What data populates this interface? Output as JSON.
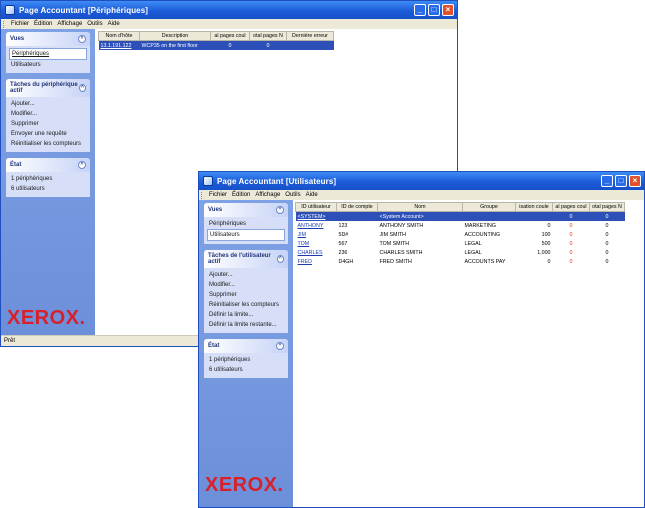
{
  "w1": {
    "title": "Page Accountant [Périphériques]",
    "menu": [
      "Fichier",
      "Édition",
      "Affichage",
      "Outils",
      "Aide"
    ],
    "panes": {
      "vues": {
        "title": "Vues",
        "items": [
          "Périphériques",
          "Utilisateurs"
        ]
      },
      "taches": {
        "title": "Tâches du périphérique actif",
        "items": [
          "Ajouter...",
          "Modifier...",
          "Supprimer",
          "Envoyer une requête",
          "Réinitialiser les compteurs"
        ]
      },
      "etat": {
        "title": "État",
        "items": [
          "1 périphériques",
          "6 utilisateurs"
        ]
      }
    },
    "logo": "XEROX.",
    "status": "Prêt",
    "table": {
      "headers": [
        "Nom d'hôte",
        "Description",
        "al pages coul",
        "otal pages N",
        "Dernière erreur"
      ],
      "rows": [
        [
          "13.1.191.122",
          "WCP35 on the first floor",
          "0",
          "0",
          ""
        ]
      ]
    }
  },
  "w2": {
    "title": "Page Accountant [Utilisateurs]",
    "menu": [
      "Fichier",
      "Édition",
      "Affichage",
      "Outils",
      "Aide"
    ],
    "panes": {
      "vues": {
        "title": "Vues",
        "items": [
          "Périphériques",
          "Utilisateurs"
        ]
      },
      "taches": {
        "title": "Tâches de l'utilisateur actif",
        "items": [
          "Ajouter...",
          "Modifier...",
          "Supprimer",
          "Réinitialiser les compteurs",
          "Définir la limite...",
          "Définir la limite restante..."
        ]
      },
      "etat": {
        "title": "État",
        "items": [
          "1 périphériques",
          "6 utilisateurs"
        ]
      }
    },
    "logo": "XEROX.",
    "table": {
      "headers": [
        "ID utilisateur",
        "ID de compte",
        "Nom",
        "Groupe",
        "isation coule",
        "al pages coul",
        "otal pages N"
      ],
      "rows": [
        [
          "<SYSTEM>",
          "",
          "<System Account>",
          "",
          "",
          "0",
          "0"
        ],
        [
          "ANTHONY",
          "123",
          "ANTHONY SMITH",
          "MARKETING",
          "0",
          "0",
          "0"
        ],
        [
          "JIM",
          "5D#",
          "JIM SMITH",
          "ACCOUNTING",
          "100",
          "0",
          "0"
        ],
        [
          "TOM",
          "567",
          "TOM SMITH",
          "LEGAL",
          "500",
          "0",
          "0"
        ],
        [
          "CHARLES",
          "236",
          "CHARLES SMITH",
          "LEGAL",
          "1,000",
          "0",
          "0"
        ],
        [
          "FRED",
          "D4GH",
          "FRED SMITH",
          "ACCOUNTS PAY",
          "0",
          "0",
          "0"
        ]
      ]
    }
  },
  "colors": {
    "titlebar": "#1d5cd8",
    "sidebar": "#7fa2e6",
    "selection": "#2d50b8",
    "logo": "#d8202a",
    "alert": "#e03020"
  },
  "icons": {
    "app": "page-accountant-app-icon",
    "minimize": "minimize-icon",
    "maximize": "maximize-icon",
    "close": "close-icon",
    "collapse": "chevron-up-icon"
  }
}
